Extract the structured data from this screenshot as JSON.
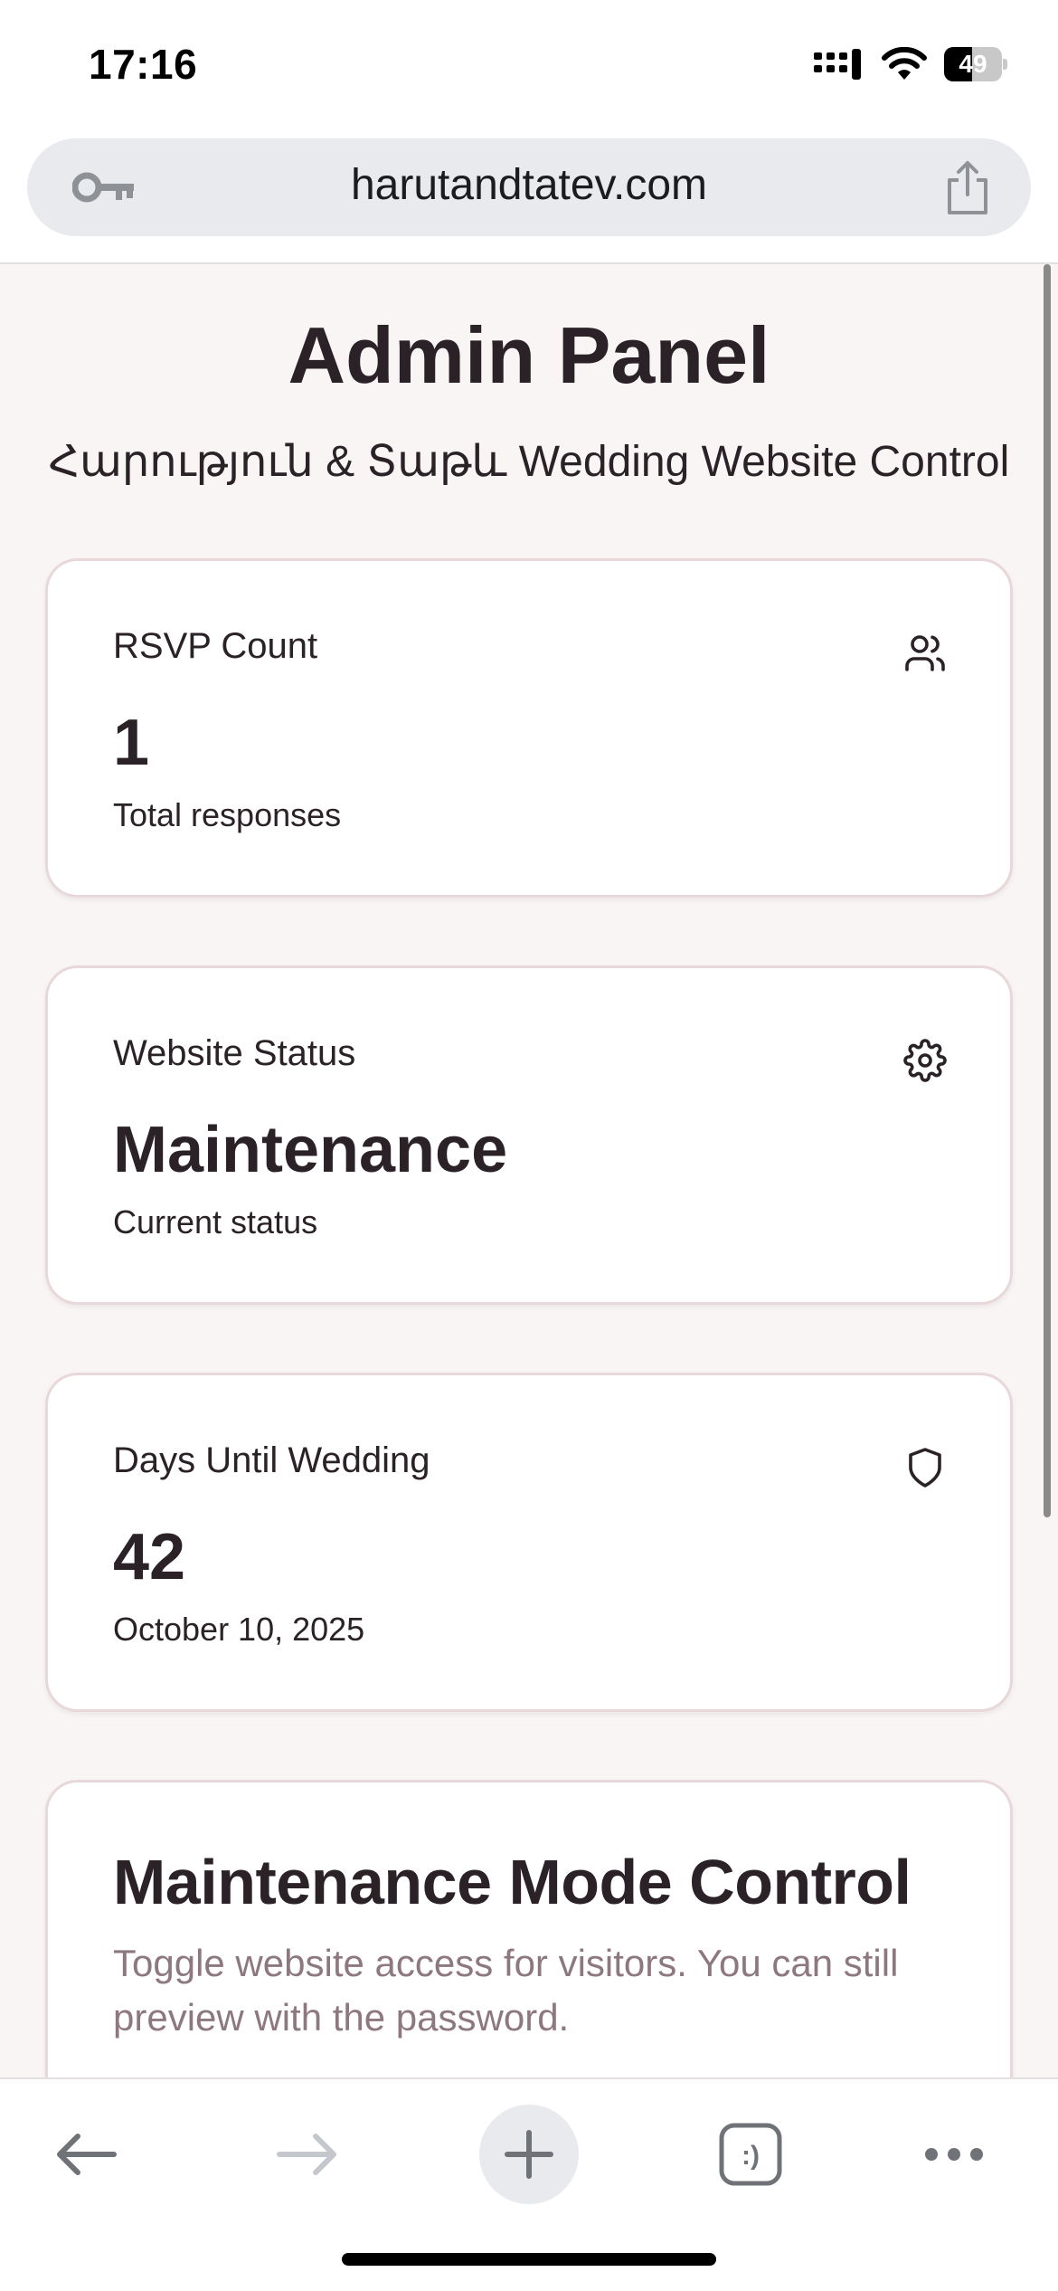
{
  "status_bar": {
    "time": "17:16",
    "battery_level": "49",
    "battery_fraction": 0.49,
    "icons": [
      "signal-icon",
      "wifi-icon",
      "battery-icon"
    ]
  },
  "browser": {
    "url": "harutandtatev.com",
    "left_icon": "key-icon",
    "right_icon": "share-icon"
  },
  "page": {
    "title": "Admin Panel",
    "subtitle": "Հարություն & Տաթև Wedding Website Control"
  },
  "cards": [
    {
      "label": "RSVP Count",
      "icon": "users-icon",
      "value": "1",
      "caption": "Total responses"
    },
    {
      "label": "Website Status",
      "icon": "gear-icon",
      "value": "Maintenance",
      "caption": "Current status"
    },
    {
      "label": "Days Until Wedding",
      "icon": "shield-icon",
      "value": "42",
      "caption": "October 10, 2025"
    }
  ],
  "maintenance": {
    "title": "Maintenance Mode Control",
    "description": "Toggle website access for visitors. You can still preview with the password."
  },
  "toolbar": {
    "items": [
      "back-arrow-icon",
      "forward-arrow-icon",
      "plus-icon",
      "tabs-icon",
      "more-icon"
    ],
    "tabs_label": ":)"
  },
  "colors": {
    "background": "#f9f5f5",
    "card_border": "#e8d8db",
    "text": "#2b2227",
    "muted": "#8e7880"
  }
}
